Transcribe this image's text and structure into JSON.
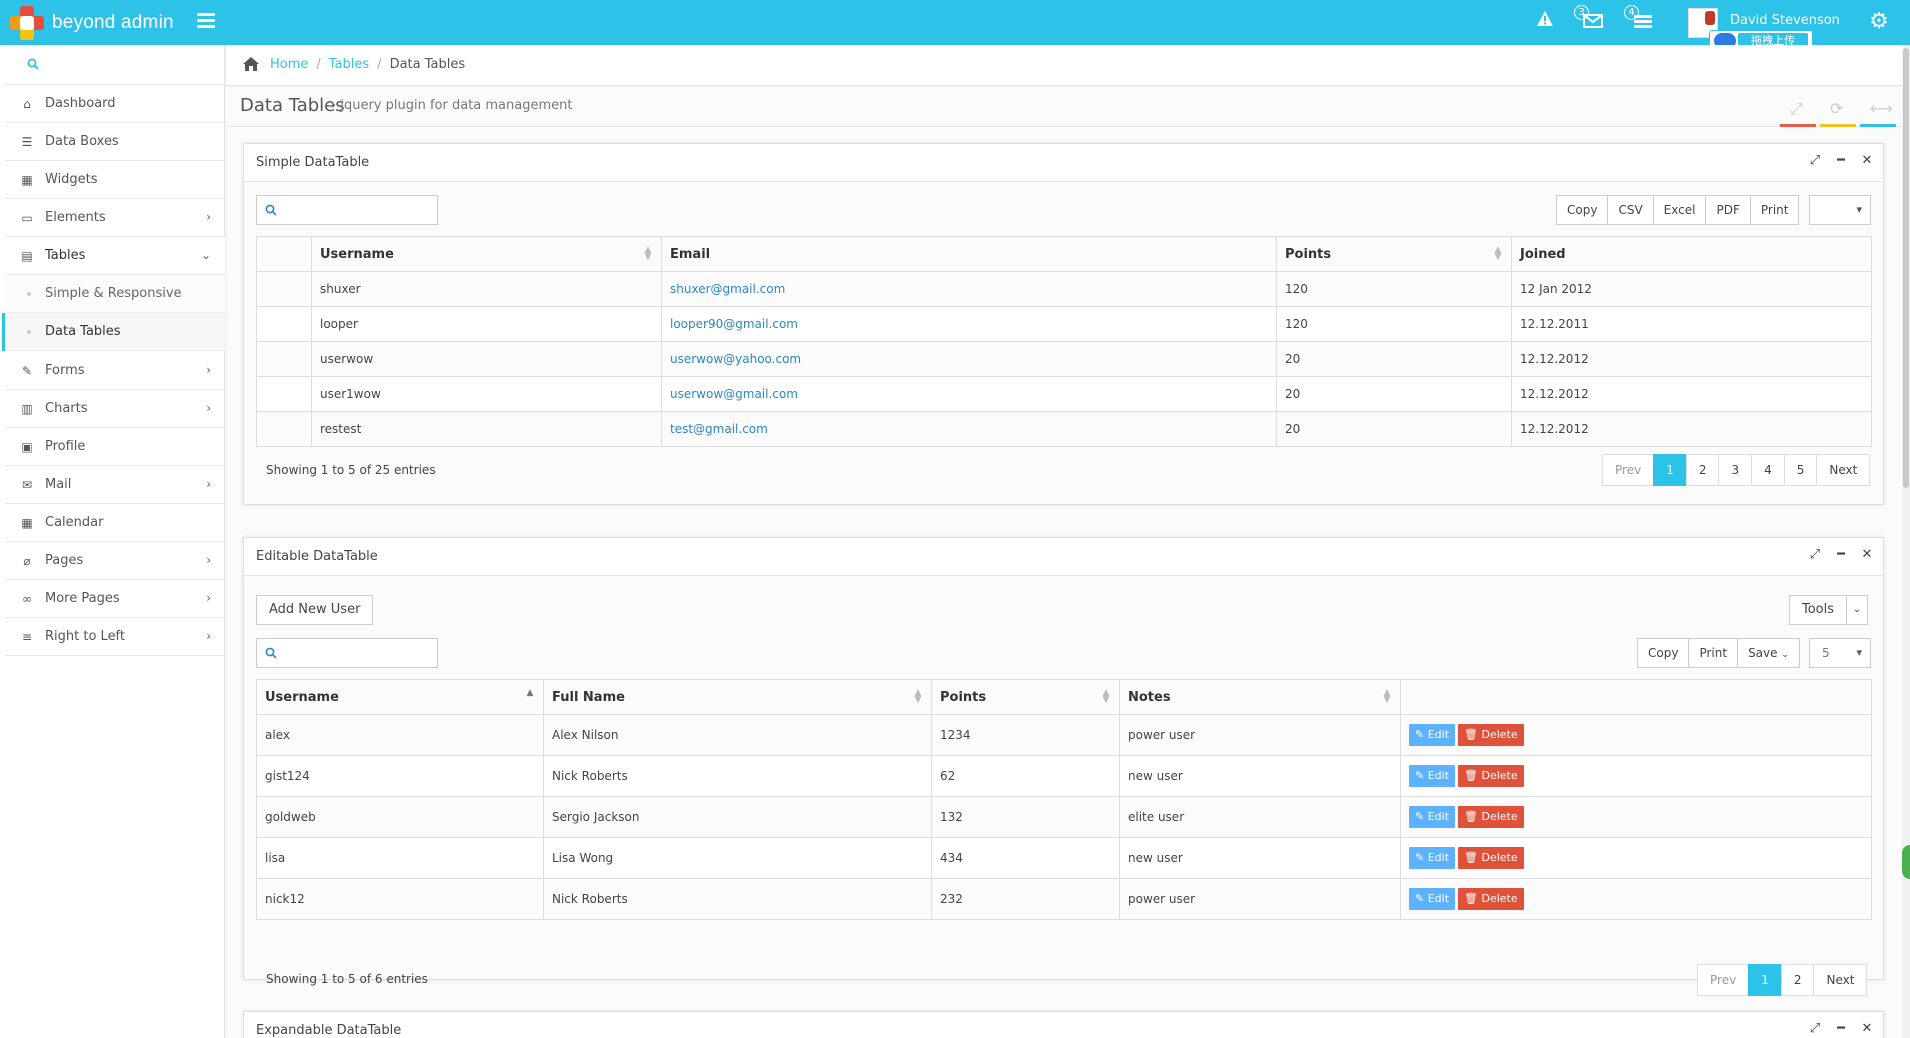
{
  "app": {
    "brand": "beyond admin",
    "user_name": "David Stevenson",
    "upload_label": "拖拽上传",
    "messages_count": "3",
    "tasks_count": "4"
  },
  "sidebar": {
    "items": [
      {
        "label": "Dashboard",
        "icon": "home-icon"
      },
      {
        "label": "Data Boxes",
        "icon": "th-icon"
      },
      {
        "label": "Widgets",
        "icon": "grid-icon"
      },
      {
        "label": "Elements",
        "icon": "desktop-icon"
      },
      {
        "label": "Tables",
        "icon": "table-icon"
      },
      {
        "label": "Forms",
        "icon": "edit-icon"
      },
      {
        "label": "Charts",
        "icon": "bar-chart-icon"
      },
      {
        "label": "Profile",
        "icon": "picture-icon"
      },
      {
        "label": "Mail",
        "icon": "envelope-icon"
      },
      {
        "label": "Calendar",
        "icon": "calendar-icon"
      },
      {
        "label": "Pages",
        "icon": "paperclip-icon"
      },
      {
        "label": "More Pages",
        "icon": "link-icon"
      },
      {
        "label": "Right to Left",
        "icon": "align-right-icon"
      }
    ],
    "sub_items": [
      "Simple & Responsive",
      "Data Tables"
    ]
  },
  "breadcrumb": {
    "home": "Home",
    "tables": "Tables",
    "current": "Data Tables"
  },
  "page": {
    "title": "Data Tables",
    "subtitle": "jquery plugin for data management"
  },
  "simple_table": {
    "caption": "Simple DataTable",
    "buttons": [
      "Copy",
      "CSV",
      "Excel",
      "PDF",
      "Print"
    ],
    "columns": [
      "",
      "Username",
      "Email",
      "Points",
      "Joined"
    ],
    "rows": [
      {
        "username": "shuxer",
        "email": "shuxer@gmail.com",
        "points": "120",
        "joined": "12 Jan 2012"
      },
      {
        "username": "looper",
        "email": "looper90@gmail.com",
        "points": "120",
        "joined": "12.12.2011"
      },
      {
        "username": "userwow",
        "email": "userwow@yahoo.com",
        "points": "20",
        "joined": "12.12.2012"
      },
      {
        "username": "user1wow",
        "email": "userwow@gmail.com",
        "points": "20",
        "joined": "12.12.2012"
      },
      {
        "username": "restest",
        "email": "test@gmail.com",
        "points": "20",
        "joined": "12.12.2012"
      }
    ],
    "info": "Showing 1 to 5 of 25 entries",
    "pager": [
      "Prev",
      "1",
      "2",
      "3",
      "4",
      "5",
      "Next"
    ]
  },
  "editable_table": {
    "caption": "Editable DataTable",
    "add_button": "Add New User",
    "tools_button": "Tools",
    "buttons": [
      "Copy",
      "Print",
      "Save"
    ],
    "page_size": "5",
    "columns": [
      "Username",
      "Full Name",
      "Points",
      "Notes",
      ""
    ],
    "rows": [
      {
        "username": "alex",
        "full_name": "Alex Nilson",
        "points": "1234",
        "notes": "power user"
      },
      {
        "username": "gist124",
        "full_name": "Nick Roberts",
        "points": "62",
        "notes": "new user"
      },
      {
        "username": "goldweb",
        "full_name": "Sergio Jackson",
        "points": "132",
        "notes": "elite user"
      },
      {
        "username": "lisa",
        "full_name": "Lisa Wong",
        "points": "434",
        "notes": "new user"
      },
      {
        "username": "nick12",
        "full_name": "Nick Roberts",
        "points": "232",
        "notes": "power user"
      }
    ],
    "edit_label": "Edit",
    "delete_label": "Delete",
    "info": "Showing 1 to 5 of 6 entries",
    "pager": [
      "Prev",
      "1",
      "2",
      "Next"
    ]
  },
  "expandable_table": {
    "caption": "Expandable DataTable"
  },
  "colors": {
    "accent": "#2dc3e8",
    "edit": "#5db2ff",
    "delete": "#df5138",
    "bar_red": "#e75b4a",
    "bar_yellow": "#f4c022",
    "bar_blue": "#2dc3e8"
  }
}
